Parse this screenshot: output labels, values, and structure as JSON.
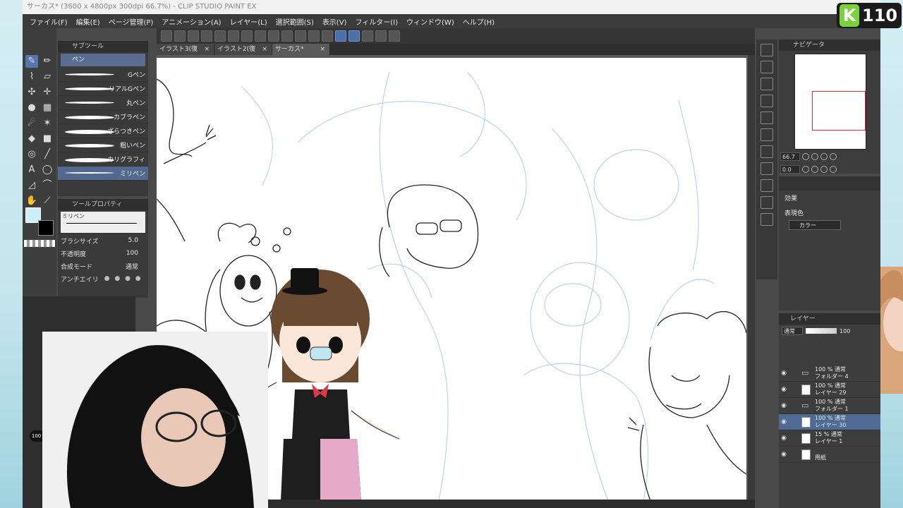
{
  "window": {
    "title": "サーカス* (3600 x 4800px 300dpi 66.7%) - CLIP STUDIO PAINT EX"
  },
  "menu": [
    "ファイル(F)",
    "編集(E)",
    "ページ管理(P)",
    "アニメーション(A)",
    "レイヤー(L)",
    "選択範囲(S)",
    "表示(V)",
    "フィルター(I)",
    "ウィンドウ(W)",
    "ヘルプ(H)"
  ],
  "tabs": [
    {
      "label": "イラスト3(復元)*",
      "close": "×"
    },
    {
      "label": "イラスト2(復元)*",
      "close": "×"
    },
    {
      "label": "サーカス*",
      "close": "×"
    }
  ],
  "subtool": {
    "header": "サブツール",
    "group_label": "ペン",
    "brushes": [
      "Gペン",
      "リアルGペン",
      "丸ペン",
      "カブラペン",
      "ざらつきペン",
      "粗いペン",
      "カリグラフィ",
      "ミリペン"
    ],
    "selected_brush": "ミリペン"
  },
  "tool_property": {
    "header": "ツールプロパティ",
    "brush_name": "ミリペン",
    "brush_size_label": "ブラシサイズ",
    "brush_size_value": "5.0",
    "opacity_label": "不透明度",
    "opacity_value": "100",
    "blend_label": "合成モード",
    "blend_value": "通常",
    "antialias_label": "アンチエイリ"
  },
  "navigator": {
    "header": "ナビゲータ",
    "zoom": "66.7",
    "rotation": "0.0"
  },
  "effect_panel": {
    "header": "効果",
    "color_expression_label": "表現色",
    "color_expression_value": "カラー"
  },
  "layer_panel": {
    "header": "レイヤー",
    "blend_mode": "通常",
    "opacity": "100",
    "layers": [
      {
        "line1": "100 % 通常",
        "line2": "フォルダー 4",
        "type": "folder"
      },
      {
        "line1": "100 % 通常",
        "line2": "レイヤー 29",
        "type": "raster"
      },
      {
        "line1": "100 % 通常",
        "line2": "フォルダー 1",
        "type": "folder"
      },
      {
        "line1": "100 % 通常",
        "line2": "レイヤー 30",
        "type": "raster",
        "selected": true
      },
      {
        "line1": "15 % 通常",
        "line2": "レイヤー 1",
        "type": "raster"
      },
      {
        "line1": "",
        "line2": "用紙",
        "type": "paper"
      }
    ]
  },
  "status": {
    "opacity_badge": "100 %"
  },
  "logo": {
    "letter": "K",
    "number": "110"
  },
  "colors": {
    "accent": "#5477b0",
    "main_color": "#cdeff7",
    "sub_color": "#000000"
  }
}
